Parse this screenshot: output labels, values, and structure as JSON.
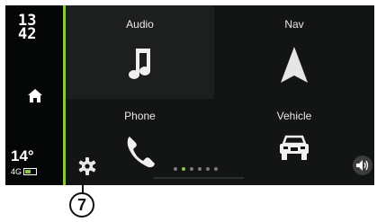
{
  "status": {
    "clock_hours": "13",
    "clock_minutes": "42",
    "temperature": "14°",
    "network": "4G"
  },
  "tiles": [
    {
      "label": "Audio",
      "icon": "music-note-icon"
    },
    {
      "label": "Nav",
      "icon": "navigation-arrow-icon"
    },
    {
      "label": "Phone",
      "icon": "phone-icon"
    },
    {
      "label": "Vehicle",
      "icon": "car-icon"
    }
  ],
  "pagination": {
    "pages": 6,
    "active_index": 1
  },
  "callout": {
    "number": "7"
  },
  "colors": {
    "accent": "#8dc63f",
    "background": "#0d0f0f",
    "tile_highlight": "#1c1f1d"
  }
}
